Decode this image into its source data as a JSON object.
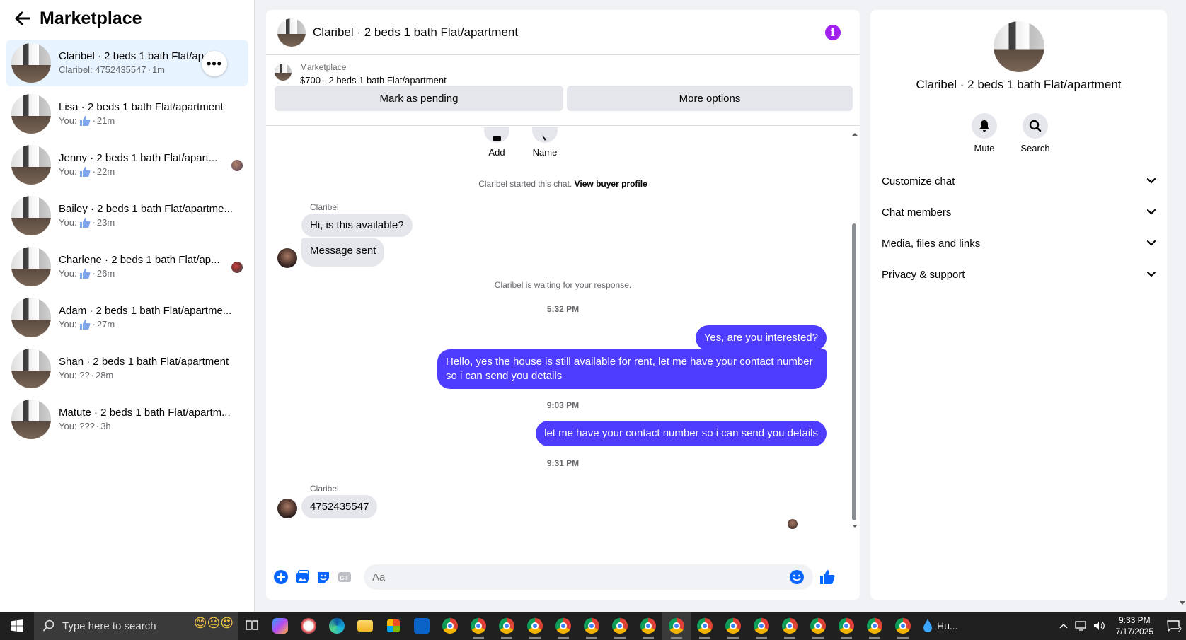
{
  "sidebar": {
    "title": "Marketplace",
    "conversations": [
      {
        "name": "Claribel · 2 beds 1 bath Flat/apartment",
        "prefix": "Claribel: 4752435547",
        "time": "1m"
      },
      {
        "name": "Lisa · 2 beds 1 bath Flat/apartment",
        "prefix": "You:",
        "time": "21m"
      },
      {
        "name": "Jenny · 2 beds 1 bath Flat/apart...",
        "prefix": "You:",
        "time": "22m"
      },
      {
        "name": "Bailey · 2 beds 1 bath Flat/apartme...",
        "prefix": "You:",
        "time": "23m"
      },
      {
        "name": "Charlene · 2 beds 1 bath Flat/ap...",
        "prefix": "You:",
        "time": "26m"
      },
      {
        "name": "Adam · 2 beds 1 bath Flat/apartme...",
        "prefix": "You:",
        "time": "27m"
      },
      {
        "name": "Shan · 2 beds 1 bath Flat/apartment",
        "prefix": "You: ??",
        "time": "28m"
      },
      {
        "name": "Matute · 2 beds 1 bath Flat/apartm...",
        "prefix": "You: ???",
        "time": "3h"
      }
    ],
    "separator": "·",
    "more_icon": "•••"
  },
  "chat": {
    "title": "Claribel · 2 beds 1 bath Flat/apartment",
    "info_icon": "i",
    "listing": {
      "source": "Marketplace",
      "price_line": "$700 - 2 beds 1 bath Flat/apartment"
    },
    "mark_pending_label": "Mark as pending",
    "more_options_label": "More options",
    "actions": {
      "add": "Add",
      "name": "Name"
    },
    "started_text": "Claribel started this chat.",
    "view_buyer_profile": "View buyer profile",
    "sender_name": "Claribel",
    "msg_in_1": "Hi, is this available?",
    "msg_in_2": "Message sent",
    "waiting_text": "Claribel is waiting for your response.",
    "time_1": "5:32 PM",
    "msg_out_1": "Yes, are you interested?",
    "msg_out_2": "Hello, yes the house is still available for rent, let me have your contact number so i can send you details",
    "time_2": "9:03 PM",
    "msg_out_3": "let me have your contact number so i can send you details",
    "time_3": "9:31 PM",
    "msg_in_3": "4752435547",
    "composer_placeholder": "Aa",
    "gif_label": "GIF"
  },
  "details": {
    "title": "Claribel · 2 beds 1 bath Flat/apartment",
    "mute_label": "Mute",
    "search_label": "Search",
    "sections": [
      "Customize chat",
      "Chat members",
      "Media, files and links",
      "Privacy & support"
    ]
  },
  "taskbar": {
    "search_placeholder": "Type here to search",
    "weather": "Hu...",
    "time": "9:33 PM",
    "date": "7/17/2025",
    "notifications": "2"
  },
  "colors": {
    "accent": "#4f3dff",
    "info": "#a020f0",
    "messenger_blue": "#0866ff"
  }
}
